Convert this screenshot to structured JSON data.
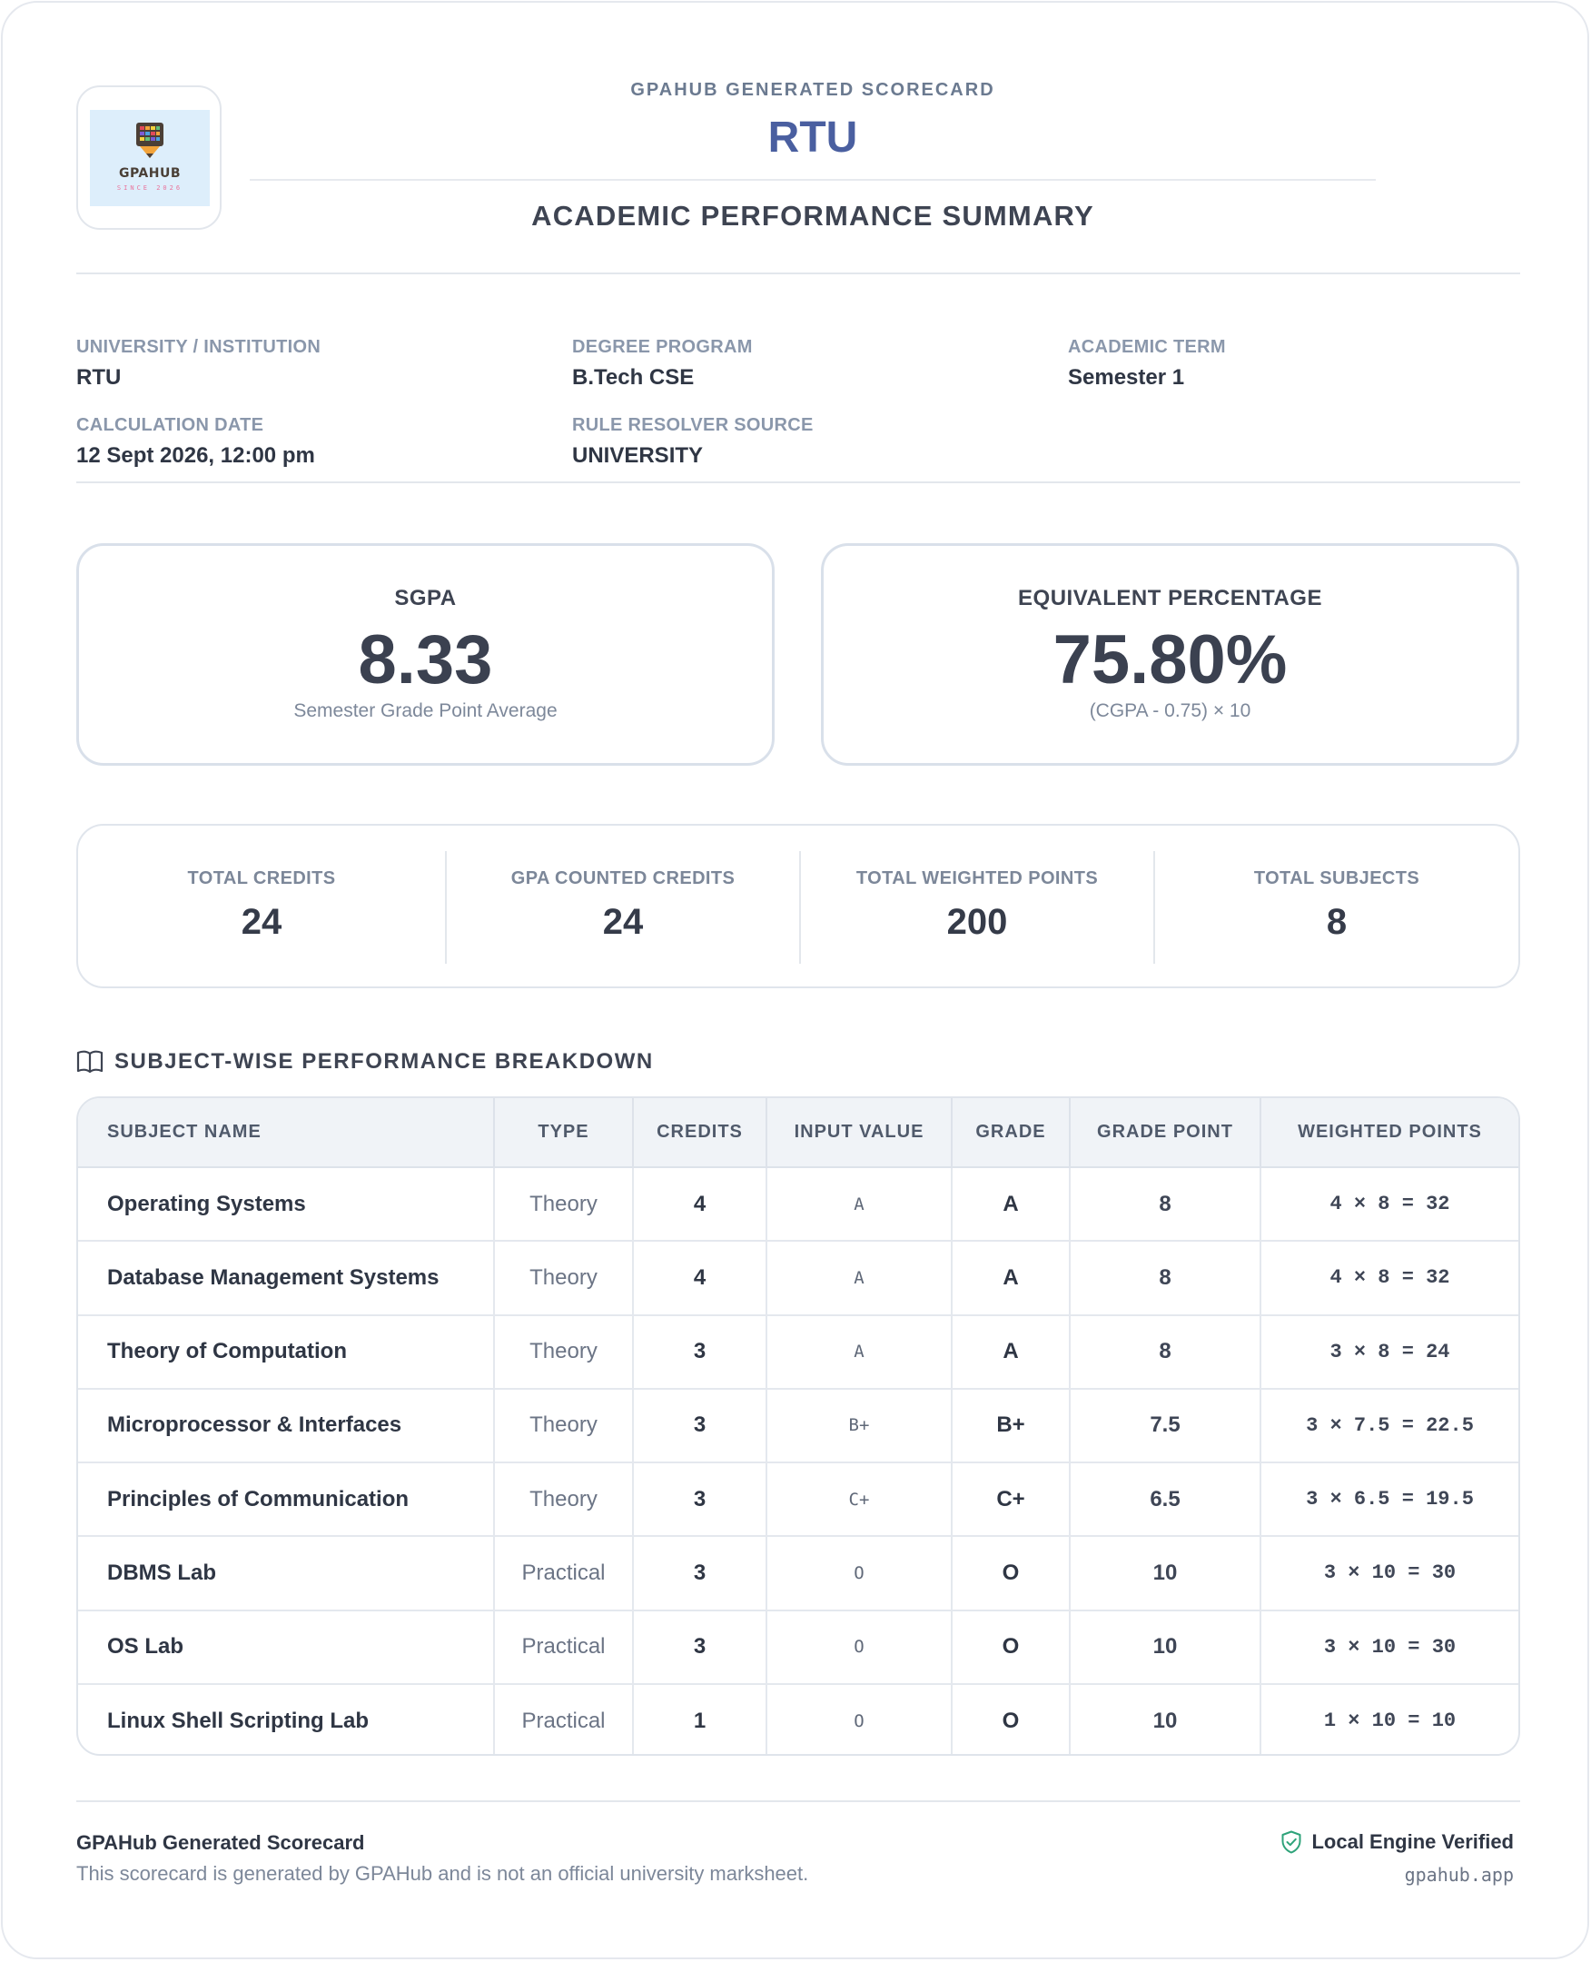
{
  "header": {
    "logo_text": "GPAHUB",
    "logo_since": "SINCE 2026",
    "kicker": "GPAHUB GENERATED SCORECARD",
    "title": "RTU",
    "subtitle": "ACADEMIC PERFORMANCE SUMMARY"
  },
  "info": {
    "university_label": "UNIVERSITY / INSTITUTION",
    "university_value": "RTU",
    "degree_label": "DEGREE PROGRAM",
    "degree_value": "B.Tech CSE",
    "term_label": "ACADEMIC TERM",
    "term_value": "Semester 1",
    "date_label": "CALCULATION DATE",
    "date_value": "12 Sept 2026, 12:00 pm",
    "source_label": "RULE RESOLVER SOURCE",
    "source_value": "UNIVERSITY"
  },
  "sgpa": {
    "label": "SGPA",
    "value": "8.33",
    "sub": "Semester Grade Point Average"
  },
  "percentage": {
    "label": "EQUIVALENT PERCENTAGE",
    "value": "75.80%",
    "sub": "(CGPA - 0.75) × 10"
  },
  "stats": {
    "total_credits_label": "TOTAL CREDITS",
    "total_credits": "24",
    "gpa_credits_label": "GPA COUNTED CREDITS",
    "gpa_credits": "24",
    "weighted_points_label": "TOTAL WEIGHTED POINTS",
    "weighted_points": "200",
    "subjects_label": "TOTAL SUBJECTS",
    "subjects": "8"
  },
  "breakdown": {
    "title": "SUBJECT-WISE PERFORMANCE BREAKDOWN",
    "icon": "book-open-icon",
    "columns": [
      "SUBJECT NAME",
      "TYPE",
      "CREDITS",
      "INPUT VALUE",
      "GRADE",
      "GRADE POINT",
      "WEIGHTED POINTS"
    ],
    "rows": [
      {
        "name": "Operating Systems",
        "type": "Theory",
        "credits": "4",
        "input": "A",
        "grade": "A",
        "gp": "8",
        "wp": "4 × 8 = 32"
      },
      {
        "name": "Database Management Systems",
        "type": "Theory",
        "credits": "4",
        "input": "A",
        "grade": "A",
        "gp": "8",
        "wp": "4 × 8 = 32"
      },
      {
        "name": "Theory of Computation",
        "type": "Theory",
        "credits": "3",
        "input": "A",
        "grade": "A",
        "gp": "8",
        "wp": "3 × 8 = 24"
      },
      {
        "name": "Microprocessor & Interfaces",
        "type": "Theory",
        "credits": "3",
        "input": "B+",
        "grade": "B+",
        "gp": "7.5",
        "wp": "3 × 7.5 = 22.5"
      },
      {
        "name": "Principles of Communication",
        "type": "Theory",
        "credits": "3",
        "input": "C+",
        "grade": "C+",
        "gp": "6.5",
        "wp": "3 × 6.5 = 19.5"
      },
      {
        "name": "DBMS Lab",
        "type": "Practical",
        "credits": "3",
        "input": "O",
        "grade": "O",
        "gp": "10",
        "wp": "3 × 10 = 30"
      },
      {
        "name": "OS Lab",
        "type": "Practical",
        "credits": "3",
        "input": "O",
        "grade": "O",
        "gp": "10",
        "wp": "3 × 10 = 30"
      },
      {
        "name": "Linux Shell Scripting Lab",
        "type": "Practical",
        "credits": "1",
        "input": "O",
        "grade": "O",
        "gp": "10",
        "wp": "1 × 10 = 10"
      }
    ]
  },
  "footer": {
    "title": "GPAHub Generated Scorecard",
    "note": "This scorecard is generated by GPAHub and is not an official university marksheet.",
    "verified": "Local Engine Verified",
    "verified_icon": "shield-check-icon",
    "site": "gpahub.app"
  },
  "colors": {
    "accent": "#4a5fa0",
    "verified_green": "#2fa37a",
    "border": "#d9e0ea"
  }
}
